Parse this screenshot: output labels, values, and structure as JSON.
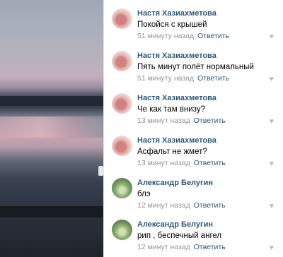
{
  "comments": [
    {
      "author": "Настя Хазиахметова",
      "text": "Покойся с крышей",
      "time": "51 минуту назад",
      "reply": "Ответить",
      "avatar": "pink"
    },
    {
      "author": "Настя Хазиахметова",
      "text": "Пять минут полёт нормальный",
      "time": "51 минуту назад",
      "reply": "Ответить",
      "avatar": "pink"
    },
    {
      "author": "Настя Хазиахметова",
      "text": "Че как там внизу?",
      "time": "13 минут назад",
      "reply": "Ответить",
      "avatar": "pink"
    },
    {
      "author": "Настя Хазиахметова",
      "text": "Асфальт не жмет?",
      "time": "13 минут назад",
      "reply": "Ответить",
      "avatar": "pink"
    },
    {
      "author": "Александр Белугин",
      "text": "блэ",
      "time": "12 минут назад",
      "reply": "Ответить",
      "avatar": "green"
    },
    {
      "author": "Александр Белугин",
      "text": "рип , беспечный ангел",
      "time": "12 минут назад",
      "reply": "Ответить",
      "avatar": "green"
    }
  ],
  "icons": {
    "like": "heart-icon"
  }
}
